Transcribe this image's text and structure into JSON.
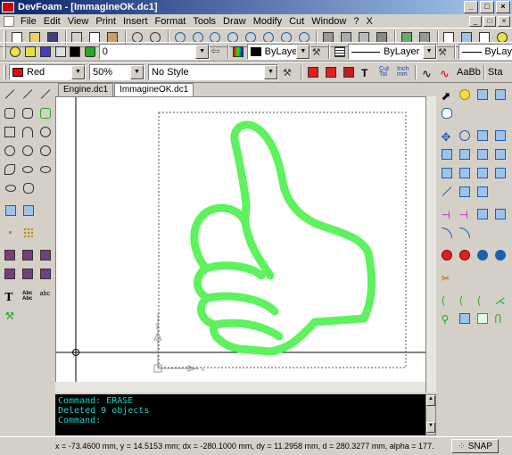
{
  "window": {
    "title": "DevFoam - [ImmagineOK.dc1]",
    "btn_min": "_",
    "btn_max": "□",
    "btn_close": "×"
  },
  "menu": {
    "items": [
      "File",
      "Edit",
      "View",
      "Print",
      "Insert",
      "Format",
      "Tools",
      "Draw",
      "Modify",
      "Cut",
      "Window",
      "?",
      "X"
    ],
    "mdi_min": "_",
    "mdi_max": "□",
    "mdi_close": "×"
  },
  "toolbar2": {
    "layer_value": "0",
    "linetype_value": "ByLayer",
    "lineweight_value": "ByLayer",
    "lineweight2_value": "ByLay"
  },
  "toolbar3": {
    "color_value": "Red",
    "color_hex": "#ff0000",
    "zoom_value": "50%",
    "style_value": "No Style",
    "text_aa": "AaBb",
    "text_sta": "Sta"
  },
  "tabs": [
    {
      "label": "Engine.dc1",
      "active": false
    },
    {
      "label": "ImmagineOK.dc1",
      "active": true
    }
  ],
  "command": {
    "lines": [
      "Command: ERASE",
      "Deleted 9 objects",
      "Command:"
    ]
  },
  "status": {
    "coords": "x = -73.4600 mm, y = 14.5153 mm; dx = -280.1000 mm, dy = 11.2958 mm, d = 280.3277 mm, alpha = 177.",
    "snap_label": "SNAP"
  },
  "colors": {
    "drawing_stroke": "#5ef25e",
    "command_text": "#16d6c8"
  }
}
